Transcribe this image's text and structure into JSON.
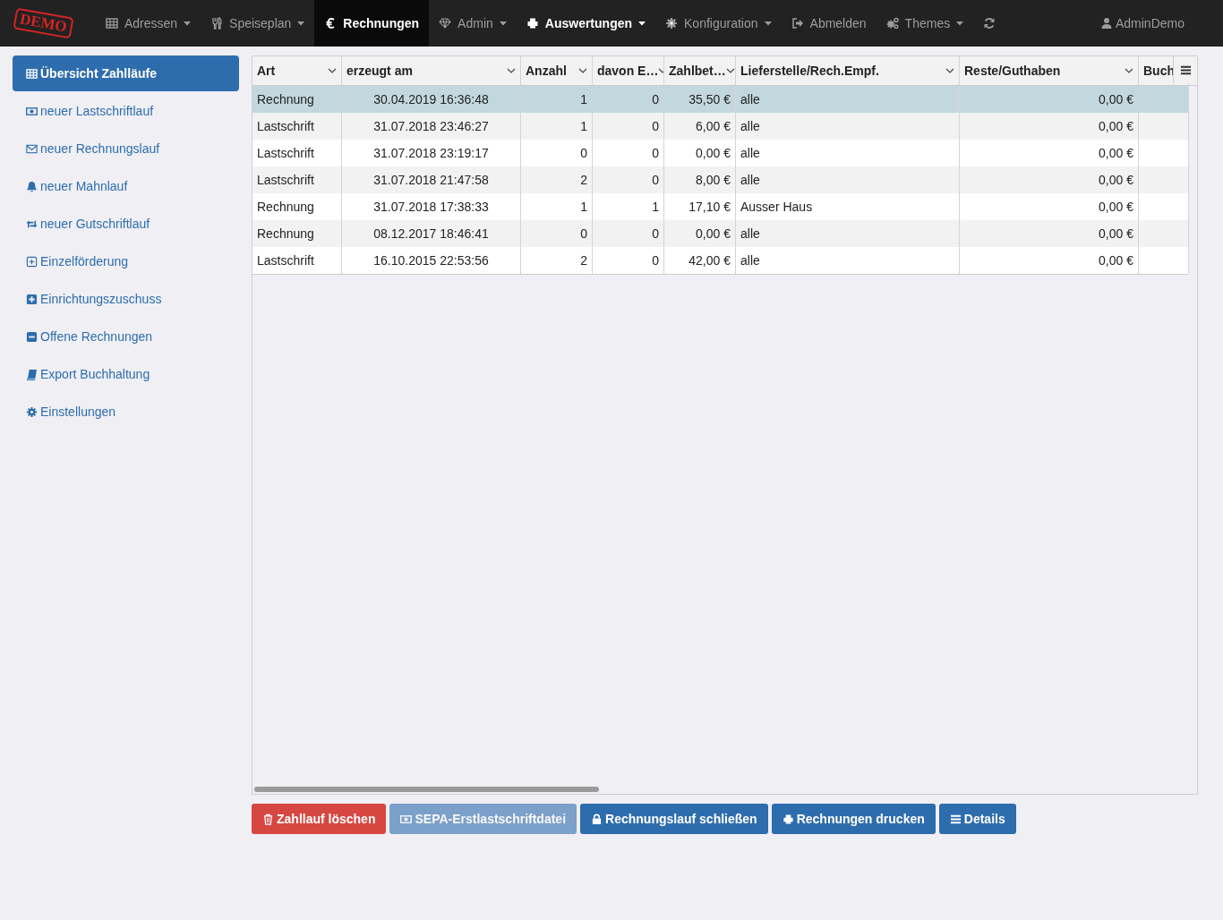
{
  "navbar": {
    "logo": "DEMO",
    "items": [
      {
        "label": "Adressen",
        "caret": true,
        "selected": false,
        "emphasized": false
      },
      {
        "label": "Speiseplan",
        "caret": true,
        "selected": false,
        "emphasized": false
      },
      {
        "label": "Rechnungen",
        "caret": false,
        "selected": true,
        "emphasized": false
      },
      {
        "label": "Admin",
        "caret": true,
        "selected": false,
        "emphasized": false
      },
      {
        "label": "Auswertungen",
        "caret": true,
        "selected": false,
        "emphasized": true
      },
      {
        "label": "Konfiguration",
        "caret": true,
        "selected": false,
        "emphasized": false
      },
      {
        "label": "Abmelden",
        "caret": false,
        "selected": false,
        "emphasized": false
      },
      {
        "label": "Themes",
        "caret": true,
        "selected": false,
        "emphasized": false
      },
      {
        "caret": false,
        "selected": false,
        "emphasized": false
      },
      {
        "label": "AdminDemo",
        "caret": false,
        "selected": false,
        "emphasized": false
      }
    ]
  },
  "sidebar": {
    "items": [
      {
        "label": "Übersicht Zahlläufe",
        "selected": true
      },
      {
        "label": "neuer Lastschriftlauf",
        "selected": false
      },
      {
        "label": "neuer Rechnungslauf",
        "selected": false
      },
      {
        "label": "neuer Mahnlauf",
        "selected": false
      },
      {
        "label": "neuer Gutschriftlauf",
        "selected": false
      },
      {
        "label": "Einzelförderung",
        "selected": false
      },
      {
        "label": "Einrichtungszuschuss",
        "selected": false
      },
      {
        "label": "Offene Rechnungen",
        "selected": false
      },
      {
        "label": "Export Buchhaltung",
        "selected": false
      },
      {
        "label": "Einstellungen",
        "selected": false
      }
    ]
  },
  "table": {
    "columns": [
      {
        "label": "Art"
      },
      {
        "label": "erzeugt am"
      },
      {
        "label": "Anzahl"
      },
      {
        "label": "davon E…"
      },
      {
        "label": "Zahlbet…"
      },
      {
        "label": "Lieferstelle/Rech.Empf."
      },
      {
        "label": "Reste/Guthaben"
      },
      {
        "label": "Buch"
      }
    ],
    "rows": [
      {
        "selected": true,
        "cells": [
          "Rechnung",
          "30.04.2019 16:36:48",
          "1",
          "0",
          "35,50 €",
          "alle",
          "0,00 €"
        ]
      },
      {
        "selected": false,
        "cells": [
          "Lastschrift",
          "31.07.2018 23:46:27",
          "1",
          "0",
          "6,00 €",
          "alle",
          "0,00 €"
        ]
      },
      {
        "selected": false,
        "cells": [
          "Lastschrift",
          "31.07.2018 23:19:17",
          "0",
          "0",
          "0,00 €",
          "alle",
          "0,00 €"
        ]
      },
      {
        "selected": false,
        "cells": [
          "Lastschrift",
          "31.07.2018 21:47:58",
          "2",
          "0",
          "8,00 €",
          "alle",
          "0,00 €"
        ]
      },
      {
        "selected": false,
        "cells": [
          "Rechnung",
          "31.07.2018 17:38:33",
          "1",
          "1",
          "17,10 €",
          "Ausser Haus",
          "0,00 €"
        ]
      },
      {
        "selected": false,
        "cells": [
          "Rechnung",
          "08.12.2017 18:46:41",
          "0",
          "0",
          "0,00 €",
          "alle",
          "0,00 €"
        ]
      },
      {
        "selected": false,
        "cells": [
          "Lastschrift",
          "16.10.2015 22:53:56",
          "2",
          "0",
          "42,00 €",
          "alle",
          "0,00 €"
        ]
      }
    ]
  },
  "actions": [
    {
      "kind": "danger",
      "label": "Zahllauf löschen",
      "disabled": false
    },
    {
      "kind": "primary",
      "label": "SEPA-Erstlastschriftdatei",
      "disabled": true
    },
    {
      "kind": "primary",
      "label": "Rechnungslauf schließen",
      "disabled": false
    },
    {
      "kind": "primary",
      "label": "Rechnungen drucken",
      "disabled": false
    },
    {
      "kind": "primary",
      "label": "Details",
      "disabled": false
    }
  ]
}
